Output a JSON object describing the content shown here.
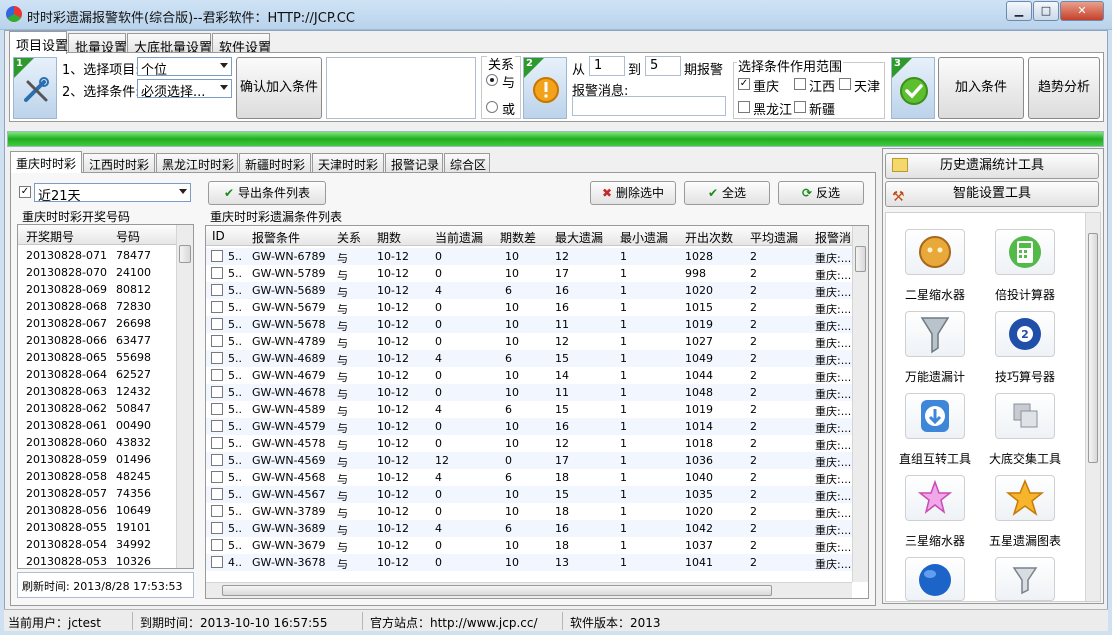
{
  "window": {
    "title": "时时彩遗漏报警软件(综合版)--君彩软件：HTTP://JCP.CC",
    "min": "▁",
    "max": "□",
    "close": "✕"
  },
  "top_tabs": [
    "项目设置",
    "批量设置",
    "大底批量设置",
    "软件设置"
  ],
  "step1": {
    "num": "1",
    "item_label": "1、选择项目:",
    "item_value": "个位",
    "cond_label": "2、选择条件:",
    "cond_value": "必须选择...",
    "confirm_button": "确认加入条件"
  },
  "relation": {
    "title": "关系",
    "and": "与",
    "or": "或",
    "selected": "与"
  },
  "step2": {
    "num": "2",
    "from_label": "从",
    "from_value": "1",
    "to_label": "到",
    "to_value": "5",
    "period_label": "期报警",
    "msg_label": "报警消息:",
    "msg_value": ""
  },
  "scope": {
    "title": "选择条件作用范围",
    "items": [
      {
        "label": "重庆",
        "checked": true
      },
      {
        "label": "江西",
        "checked": false
      },
      {
        "label": "天津",
        "checked": false
      },
      {
        "label": "黑龙江",
        "checked": false
      },
      {
        "label": "新疆",
        "checked": false
      }
    ]
  },
  "step3": {
    "num": "3",
    "add_button": "加入条件",
    "trend_button": "趋势分析"
  },
  "region_tabs": [
    "重庆时时彩",
    "江西时时彩",
    "黑龙江时时彩",
    "新疆时时彩",
    "天津时时彩",
    "报警记录",
    "综合区"
  ],
  "left_panel": {
    "range_checked": true,
    "range_value": "近21天",
    "list_title": "重庆时时彩开奖号码",
    "col_period": "开奖期号",
    "col_number": "号码",
    "draws": [
      [
        "20130828-071",
        "78477"
      ],
      [
        "20130828-070",
        "24100"
      ],
      [
        "20130828-069",
        "80812"
      ],
      [
        "20130828-068",
        "72830"
      ],
      [
        "20130828-067",
        "26698"
      ],
      [
        "20130828-066",
        "63477"
      ],
      [
        "20130828-065",
        "55698"
      ],
      [
        "20130828-064",
        "62527"
      ],
      [
        "20130828-063",
        "12432"
      ],
      [
        "20130828-062",
        "50847"
      ],
      [
        "20130828-061",
        "00490"
      ],
      [
        "20130828-060",
        "43832"
      ],
      [
        "20130828-059",
        "01496"
      ],
      [
        "20130828-058",
        "48245"
      ],
      [
        "20130828-057",
        "74356"
      ],
      [
        "20130828-056",
        "10649"
      ],
      [
        "20130828-055",
        "19101"
      ],
      [
        "20130828-054",
        "34992"
      ],
      [
        "20130828-053",
        "10326"
      ]
    ],
    "refresh_label": "刷新时间:",
    "refresh_time": "2013/8/28 17:53:53"
  },
  "center_panel": {
    "export_button": "导出条件列表",
    "delete_button": "删除选中",
    "all_button": "全选",
    "invert_button": "反选",
    "list_title": "重庆时时彩遗漏条件列表",
    "columns": [
      "ID",
      "报警条件",
      "关系",
      "期数",
      "当前遗漏",
      "期数差",
      "最大遗漏",
      "最小遗漏",
      "开出次数",
      "平均遗漏",
      "报警消"
    ],
    "rows": [
      [
        "5..",
        "GW-WN-6789",
        "与",
        "10-12",
        "0",
        "10",
        "12",
        "1",
        "1028",
        "2",
        "重庆:..."
      ],
      [
        "5..",
        "GW-WN-5789",
        "与",
        "10-12",
        "0",
        "10",
        "17",
        "1",
        "998",
        "2",
        "重庆:..."
      ],
      [
        "5..",
        "GW-WN-5689",
        "与",
        "10-12",
        "4",
        "6",
        "16",
        "1",
        "1020",
        "2",
        "重庆:..."
      ],
      [
        "5..",
        "GW-WN-5679",
        "与",
        "10-12",
        "0",
        "10",
        "16",
        "1",
        "1015",
        "2",
        "重庆:..."
      ],
      [
        "5..",
        "GW-WN-5678",
        "与",
        "10-12",
        "0",
        "10",
        "11",
        "1",
        "1019",
        "2",
        "重庆:..."
      ],
      [
        "5..",
        "GW-WN-4789",
        "与",
        "10-12",
        "0",
        "10",
        "12",
        "1",
        "1027",
        "2",
        "重庆:..."
      ],
      [
        "5..",
        "GW-WN-4689",
        "与",
        "10-12",
        "4",
        "6",
        "15",
        "1",
        "1049",
        "2",
        "重庆:..."
      ],
      [
        "5..",
        "GW-WN-4679",
        "与",
        "10-12",
        "0",
        "10",
        "14",
        "1",
        "1044",
        "2",
        "重庆:..."
      ],
      [
        "5..",
        "GW-WN-4678",
        "与",
        "10-12",
        "0",
        "10",
        "11",
        "1",
        "1048",
        "2",
        "重庆:..."
      ],
      [
        "5..",
        "GW-WN-4589",
        "与",
        "10-12",
        "4",
        "6",
        "15",
        "1",
        "1019",
        "2",
        "重庆:..."
      ],
      [
        "5..",
        "GW-WN-4579",
        "与",
        "10-12",
        "0",
        "10",
        "16",
        "1",
        "1014",
        "2",
        "重庆:..."
      ],
      [
        "5..",
        "GW-WN-4578",
        "与",
        "10-12",
        "0",
        "10",
        "12",
        "1",
        "1018",
        "2",
        "重庆:..."
      ],
      [
        "5..",
        "GW-WN-4569",
        "与",
        "10-12",
        "12",
        "0",
        "17",
        "1",
        "1036",
        "2",
        "重庆:..."
      ],
      [
        "5..",
        "GW-WN-4568",
        "与",
        "10-12",
        "4",
        "6",
        "18",
        "1",
        "1040",
        "2",
        "重庆:..."
      ],
      [
        "5..",
        "GW-WN-4567",
        "与",
        "10-12",
        "0",
        "10",
        "15",
        "1",
        "1035",
        "2",
        "重庆:..."
      ],
      [
        "5..",
        "GW-WN-3789",
        "与",
        "10-12",
        "0",
        "10",
        "18",
        "1",
        "1020",
        "2",
        "重庆:..."
      ],
      [
        "5..",
        "GW-WN-3689",
        "与",
        "10-12",
        "4",
        "6",
        "16",
        "1",
        "1042",
        "2",
        "重庆:..."
      ],
      [
        "5..",
        "GW-WN-3679",
        "与",
        "10-12",
        "0",
        "10",
        "18",
        "1",
        "1037",
        "2",
        "重庆:..."
      ],
      [
        "4..",
        "GW-WN-3678",
        "与",
        "10-12",
        "0",
        "10",
        "13",
        "1",
        "1041",
        "2",
        "重庆:..."
      ]
    ]
  },
  "right_panel": {
    "history_button": "历史遗漏统计工具",
    "smart_button": "智能设置工具",
    "tools": [
      {
        "label": "二星缩水器",
        "icon": "coins-icon"
      },
      {
        "label": "倍投计算器",
        "icon": "calculator-icon"
      },
      {
        "label": "万能遗漏计",
        "icon": "funnel-icon"
      },
      {
        "label": "技巧算号器",
        "icon": "ball-two-icon"
      },
      {
        "label": "直组互转工具",
        "icon": "download-icon"
      },
      {
        "label": "大底交集工具",
        "icon": "overlap-icon"
      },
      {
        "label": "三星缩水器",
        "icon": "stars-icon"
      },
      {
        "label": "五星遗漏图表",
        "icon": "star-icon"
      },
      {
        "label": "",
        "icon": "globe-icon"
      },
      {
        "label": "",
        "icon": "filter-icon"
      }
    ]
  },
  "status_bar": {
    "user": "当前用户：jctest",
    "expiry": "到期时间：2013-10-10 16:57:55",
    "site": "官方站点：http://www.jcp.cc/",
    "version": "软件版本：2013"
  },
  "colors": {
    "progress": "#1fae1f",
    "accent": "#2e9a2e",
    "delete": "#c62828"
  }
}
